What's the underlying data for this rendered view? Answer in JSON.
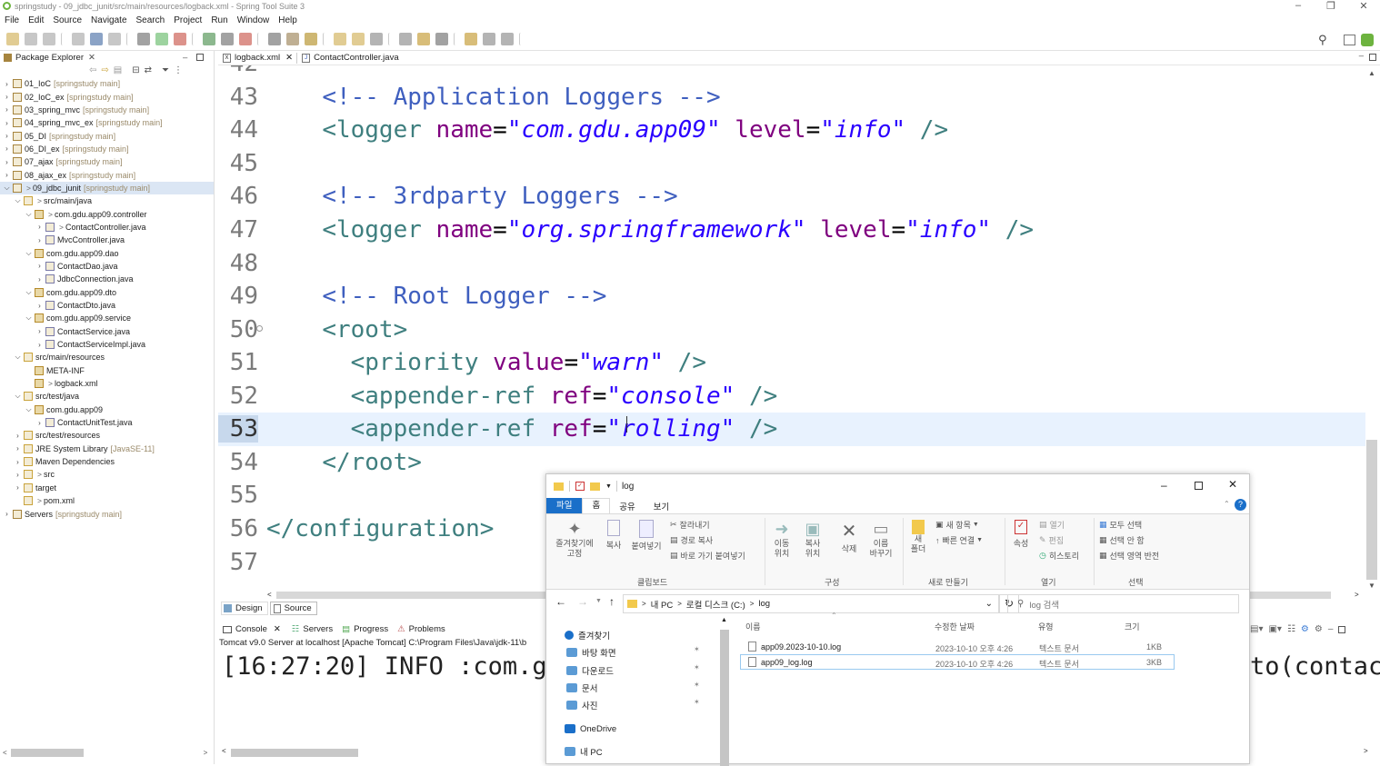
{
  "window": {
    "title": "springstudy - 09_jdbc_junit/src/main/resources/logback.xml - Spring Tool Suite 3"
  },
  "menu": [
    "File",
    "Edit",
    "Source",
    "Navigate",
    "Search",
    "Project",
    "Run",
    "Window",
    "Help"
  ],
  "package_explorer": {
    "title": "Package Explorer",
    "items": [
      {
        "label": "01_IoC",
        "suffix": "[springstudy main]",
        "depth": 0,
        "tw": ">",
        "gt": ""
      },
      {
        "label": "02_IoC_ex",
        "suffix": "[springstudy main]",
        "depth": 0,
        "tw": ">",
        "gt": ""
      },
      {
        "label": "03_spring_mvc",
        "suffix": "[springstudy main]",
        "depth": 0,
        "tw": ">",
        "gt": ""
      },
      {
        "label": "04_spring_mvc_ex",
        "suffix": "[springstudy main]",
        "depth": 0,
        "tw": ">",
        "gt": ""
      },
      {
        "label": "05_DI",
        "suffix": "[springstudy main]",
        "depth": 0,
        "tw": ">",
        "gt": ""
      },
      {
        "label": "06_DI_ex",
        "suffix": "[springstudy main]",
        "depth": 0,
        "tw": ">",
        "gt": ""
      },
      {
        "label": "07_ajax",
        "suffix": "[springstudy main]",
        "depth": 0,
        "tw": ">",
        "gt": ""
      },
      {
        "label": "08_ajax_ex",
        "suffix": "[springstudy main]",
        "depth": 0,
        "tw": ">",
        "gt": ""
      },
      {
        "label": "09_jdbc_junit",
        "suffix": "[springstudy main]",
        "depth": 0,
        "tw": "v",
        "gt": ">",
        "selected": true
      },
      {
        "label": "src/main/java",
        "suffix": "",
        "depth": 1,
        "tw": "v",
        "gt": ">"
      },
      {
        "label": "com.gdu.app09.controller",
        "suffix": "",
        "depth": 2,
        "tw": "v",
        "gt": ">"
      },
      {
        "label": "ContactController.java",
        "suffix": "",
        "depth": 3,
        "tw": ">",
        "gt": ">"
      },
      {
        "label": "MvcController.java",
        "suffix": "",
        "depth": 3,
        "tw": ">",
        "gt": ""
      },
      {
        "label": "com.gdu.app09.dao",
        "suffix": "",
        "depth": 2,
        "tw": "v",
        "gt": ""
      },
      {
        "label": "ContactDao.java",
        "suffix": "",
        "depth": 3,
        "tw": ">",
        "gt": ""
      },
      {
        "label": "JdbcConnection.java",
        "suffix": "",
        "depth": 3,
        "tw": ">",
        "gt": ""
      },
      {
        "label": "com.gdu.app09.dto",
        "suffix": "",
        "depth": 2,
        "tw": "v",
        "gt": ""
      },
      {
        "label": "ContactDto.java",
        "suffix": "",
        "depth": 3,
        "tw": ">",
        "gt": ""
      },
      {
        "label": "com.gdu.app09.service",
        "suffix": "",
        "depth": 2,
        "tw": "v",
        "gt": ""
      },
      {
        "label": "ContactService.java",
        "suffix": "",
        "depth": 3,
        "tw": ">",
        "gt": ""
      },
      {
        "label": "ContactServiceImpl.java",
        "suffix": "",
        "depth": 3,
        "tw": ">",
        "gt": ""
      },
      {
        "label": "src/main/resources",
        "suffix": "",
        "depth": 1,
        "tw": "v",
        "gt": ""
      },
      {
        "label": "META-INF",
        "suffix": "",
        "depth": 2,
        "tw": "",
        "gt": ""
      },
      {
        "label": "logback.xml",
        "suffix": "",
        "depth": 2,
        "tw": "",
        "gt": ">"
      },
      {
        "label": "src/test/java",
        "suffix": "",
        "depth": 1,
        "tw": "v",
        "gt": ""
      },
      {
        "label": "com.gdu.app09",
        "suffix": "",
        "depth": 2,
        "tw": "v",
        "gt": ""
      },
      {
        "label": "ContactUnitTest.java",
        "suffix": "",
        "depth": 3,
        "tw": ">",
        "gt": ""
      },
      {
        "label": "src/test/resources",
        "suffix": "",
        "depth": 1,
        "tw": ">",
        "gt": ""
      },
      {
        "label": "JRE System Library",
        "suffix": "[JavaSE-11]",
        "depth": 1,
        "tw": ">",
        "gt": ""
      },
      {
        "label": "Maven Dependencies",
        "suffix": "",
        "depth": 1,
        "tw": ">",
        "gt": ""
      },
      {
        "label": "src",
        "suffix": "",
        "depth": 1,
        "tw": ">",
        "gt": ">"
      },
      {
        "label": "target",
        "suffix": "",
        "depth": 1,
        "tw": ">",
        "gt": ""
      },
      {
        "label": "pom.xml",
        "suffix": "",
        "depth": 1,
        "tw": "",
        "gt": ">"
      },
      {
        "label": "Servers",
        "suffix": "[springstudy main]",
        "depth": 0,
        "tw": ">",
        "gt": ""
      }
    ]
  },
  "editor": {
    "tabs": [
      {
        "label": "logback.xml",
        "active": true
      },
      {
        "label": "ContactController.java",
        "active": false
      }
    ],
    "lines": [
      {
        "n": "42",
        "parts": []
      },
      {
        "n": "43",
        "parts": [
          [
            "cm",
            "<!-- Application Loggers -->"
          ]
        ],
        "indent": 1
      },
      {
        "n": "44",
        "parts": [
          [
            "tag",
            "<logger "
          ],
          [
            "at",
            "name"
          ],
          [
            "pn",
            "="
          ],
          [
            "st",
            "\"com.gdu.app09\""
          ],
          [
            "at",
            " level"
          ],
          [
            "pn",
            "="
          ],
          [
            "st",
            "\"info\""
          ],
          [
            "tag",
            " />"
          ]
        ],
        "indent": 1
      },
      {
        "n": "45",
        "parts": []
      },
      {
        "n": "46",
        "parts": [
          [
            "cm",
            "<!-- 3rdparty Loggers -->"
          ]
        ],
        "indent": 1
      },
      {
        "n": "47",
        "parts": [
          [
            "tag",
            "<logger "
          ],
          [
            "at",
            "name"
          ],
          [
            "pn",
            "="
          ],
          [
            "st",
            "\"org.springframework\""
          ],
          [
            "at",
            " level"
          ],
          [
            "pn",
            "="
          ],
          [
            "st",
            "\"info\""
          ],
          [
            "tag",
            " />"
          ]
        ],
        "indent": 1
      },
      {
        "n": "48",
        "parts": []
      },
      {
        "n": "49",
        "parts": [
          [
            "cm",
            "<!-- Root Logger -->"
          ]
        ],
        "indent": 1
      },
      {
        "n": "50",
        "parts": [
          [
            "tag",
            "<root>"
          ]
        ],
        "indent": 1
      },
      {
        "n": "51",
        "parts": [
          [
            "tag",
            "<priority "
          ],
          [
            "at",
            "value"
          ],
          [
            "pn",
            "="
          ],
          [
            "st",
            "\"warn\""
          ],
          [
            "tag",
            " />"
          ]
        ],
        "indent": 2
      },
      {
        "n": "52",
        "parts": [
          [
            "tag",
            "<appender-ref "
          ],
          [
            "at",
            "ref"
          ],
          [
            "pn",
            "="
          ],
          [
            "st",
            "\"console\""
          ],
          [
            "tag",
            " />"
          ]
        ],
        "indent": 2
      },
      {
        "n": "53",
        "parts": [
          [
            "tag",
            "<appender-ref "
          ],
          [
            "at",
            "ref"
          ],
          [
            "pn",
            "="
          ],
          [
            "st",
            "\"rolling\""
          ],
          [
            "tag",
            " />"
          ]
        ],
        "indent": 2,
        "current": true
      },
      {
        "n": "54",
        "parts": [
          [
            "tag",
            "</root>"
          ]
        ],
        "indent": 1
      },
      {
        "n": "55",
        "parts": []
      },
      {
        "n": "56",
        "parts": [
          [
            "tag",
            "</configuration>"
          ]
        ],
        "indent": 0
      },
      {
        "n": "57",
        "parts": []
      }
    ],
    "bottom_tabs": [
      "Design",
      "Source"
    ]
  },
  "console": {
    "tabs": [
      "Console",
      "Servers",
      "Progress",
      "Problems"
    ],
    "server_line": "Tomcat v9.0 Server at localhost [Apache Tomcat] C:\\Program Files\\Java\\jdk-11\\b",
    "log_text": "[16:27:20] INFO :com.gc",
    "log_tail": "to(contac"
  },
  "explorer": {
    "title": "log",
    "ribbon_tabs": [
      "파일",
      "홈",
      "공유",
      "보기"
    ],
    "ribbon": {
      "clipboard": {
        "pin": "즐겨찾기에\n고정",
        "copy": "복사",
        "paste": "붙여넣기",
        "cut": "잘라내기",
        "copy_path": "경로 복사",
        "paste_shortcut": "바로 가기 붙여넣기",
        "group": "클립보드"
      },
      "organize": {
        "move": "이동\n위치",
        "copy_to": "복사\n위치",
        "delete": "삭제",
        "rename": "이름\n바꾸기",
        "group": "구성"
      },
      "new": {
        "folder": "새\n폴더",
        "new_item": "새 항목",
        "easy_access": "빠른 연결",
        "group": "새로 만들기"
      },
      "open": {
        "properties": "속성",
        "open": "열기",
        "edit": "편집",
        "history": "히스토리",
        "group": "열기"
      },
      "select": {
        "all": "모두 선택",
        "none": "선택 안 함",
        "invert": "선택 영역 반전",
        "group": "선택"
      }
    },
    "path": [
      "내 PC",
      "로컬 디스크 (C:)",
      "log"
    ],
    "search_placeholder": "log 검색",
    "nav": [
      {
        "label": "즐겨찾기",
        "pinned": false
      },
      {
        "label": "바탕 화면",
        "pinned": true
      },
      {
        "label": "다운로드",
        "pinned": true
      },
      {
        "label": "문서",
        "pinned": true
      },
      {
        "label": "사진",
        "pinned": true
      },
      {
        "label": "OneDrive",
        "pinned": false
      },
      {
        "label": "내 PC",
        "pinned": false
      }
    ],
    "columns": [
      "이름",
      "수정한 날짜",
      "유형",
      "크기"
    ],
    "files": [
      {
        "name": "app09.2023-10-10.log",
        "date": "2023-10-10 오후 4:26",
        "type": "텍스트 문서",
        "size": "1KB"
      },
      {
        "name": "app09_log.log",
        "date": "2023-10-10 오후 4:26",
        "type": "텍스트 문서",
        "size": "3KB",
        "selected": true
      }
    ]
  }
}
